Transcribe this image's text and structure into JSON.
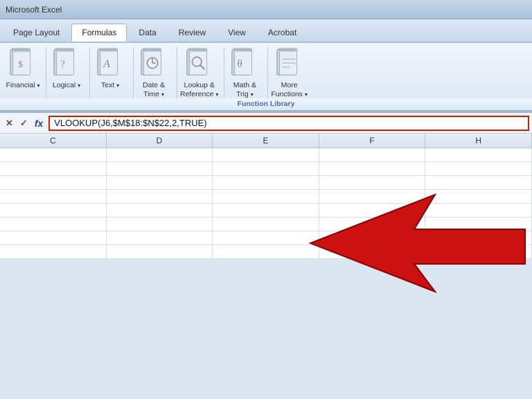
{
  "titlebar": {
    "text": "Microsoft Excel"
  },
  "tabs": [
    {
      "label": "Page Layout",
      "active": false
    },
    {
      "label": "Formulas",
      "active": true
    },
    {
      "label": "Data",
      "active": false
    },
    {
      "label": "Review",
      "active": false
    },
    {
      "label": "View",
      "active": false
    },
    {
      "label": "Acrobat",
      "active": false
    }
  ],
  "ribbon": {
    "group_label": "Function Library",
    "items": [
      {
        "label": "Financial",
        "sublabel": "▾"
      },
      {
        "label": "Logical",
        "sublabel": "▾"
      },
      {
        "label": "Text",
        "sublabel": "▾"
      },
      {
        "label": "Date &\nTime",
        "sublabel": "▾"
      },
      {
        "label": "Lookup &\nReference",
        "sublabel": "▾"
      },
      {
        "label": "Math &\nTrig",
        "sublabel": "▾"
      },
      {
        "label": "More\nFunctions",
        "sublabel": "▾"
      }
    ]
  },
  "formulabar": {
    "cancel_label": "✕",
    "confirm_label": "✓",
    "fx_label": "fx",
    "formula": "VLOOKUP(J6,$M$18:$N$22,2,TRUE)"
  },
  "columns": [
    "C",
    "D",
    "E",
    "F",
    "H"
  ],
  "rows": 8,
  "arrow": {
    "color": "#cc1111"
  }
}
